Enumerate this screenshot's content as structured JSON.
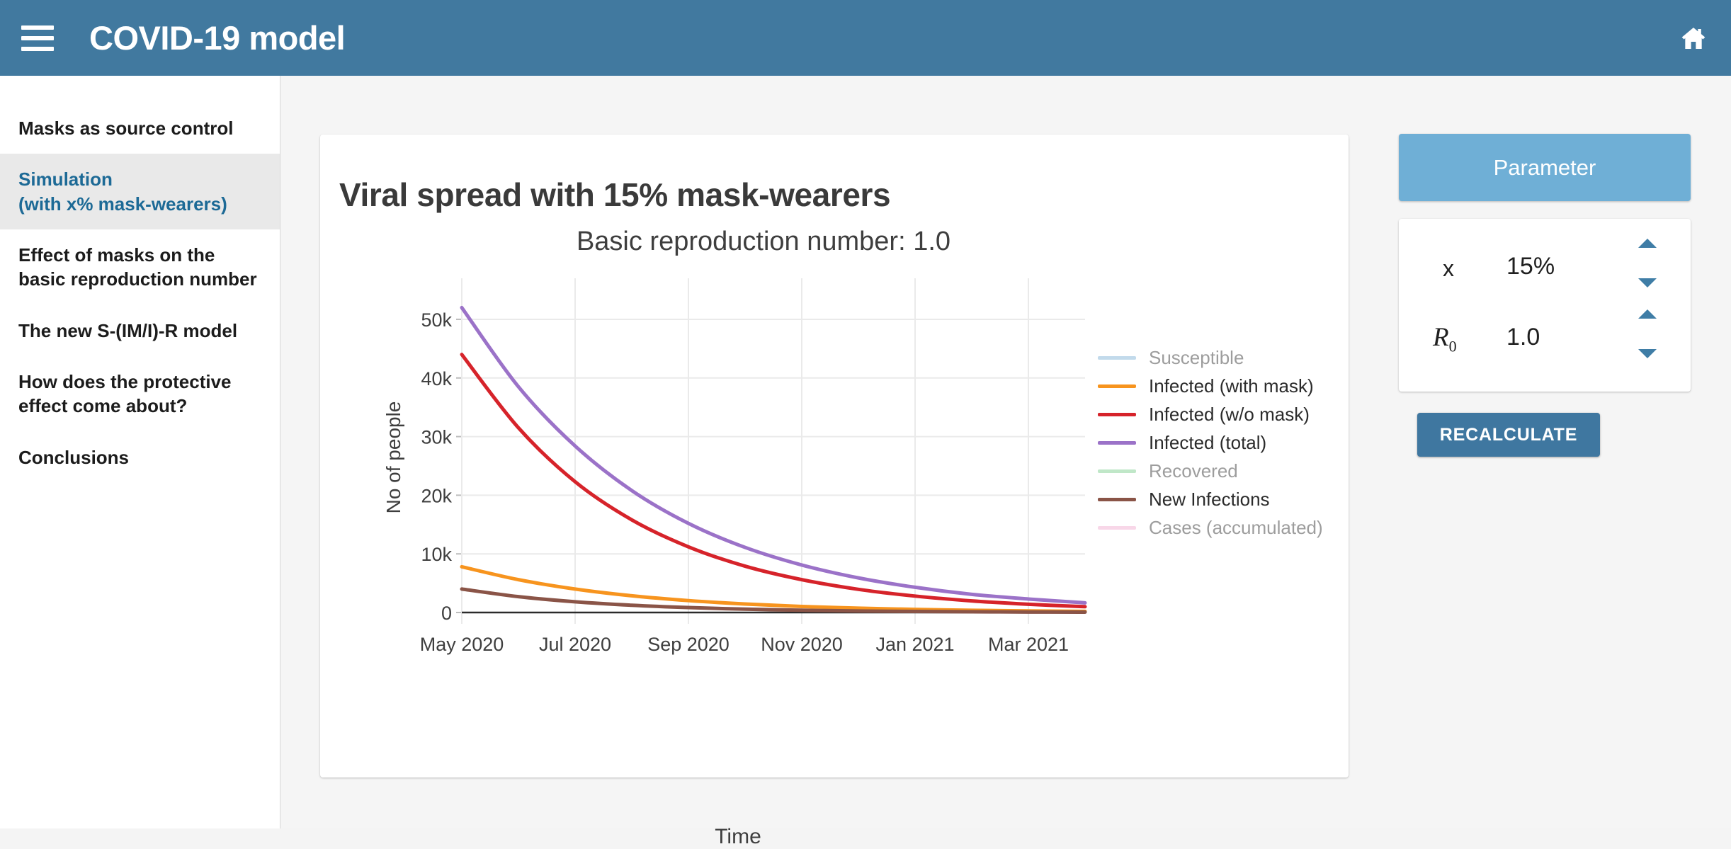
{
  "header": {
    "title": "COVID-19 model",
    "menu_icon": "hamburger-icon",
    "home_icon": "home-icon",
    "background_color": "#41799f"
  },
  "sidebar": {
    "items": [
      {
        "label": "Masks as source control",
        "active": false
      },
      {
        "label": "Simulation\n(with x% mask-wearers)",
        "active": true
      },
      {
        "label": "Effect of masks on the basic reproduction number",
        "active": false
      },
      {
        "label": "The new S-(IM/I)-R model",
        "active": false
      },
      {
        "label": "How does the protective effect come about?",
        "active": false
      },
      {
        "label": "Conclusions",
        "active": false
      }
    ],
    "active_color": "#1d6a96",
    "active_background": "#e9e9e9"
  },
  "parameters": {
    "header_label": "Parameter",
    "rows": [
      {
        "symbol": "x",
        "symbol_style": "plain",
        "value": "15%"
      },
      {
        "symbol": "R",
        "symbol_sub": "0",
        "symbol_style": "math",
        "value": "1.0"
      }
    ],
    "spinner_up_icon": "triangle-up-icon",
    "spinner_down_icon": "triangle-down-icon",
    "recalculate_label": "RECALCULATE",
    "accent_color": "#3f77a0",
    "header_color": "#6fafd6"
  },
  "chart_data": {
    "type": "line",
    "title": "Viral spread with 15% mask-wearers",
    "subtitle": "Basic reproduction number: 1.0",
    "xlabel": "Time",
    "ylabel": "No of people",
    "grid": true,
    "legend_position": "right",
    "xtick_labels": [
      "May 2020",
      "Jul 2020",
      "Sep 2020",
      "Nov 2020",
      "Jan 2021",
      "Mar 2021"
    ],
    "ytick_labels": [
      "0",
      "10k",
      "20k",
      "30k",
      "40k",
      "50k"
    ],
    "ytick_values": [
      0,
      10000,
      20000,
      30000,
      40000,
      50000
    ],
    "ylim": [
      0,
      57000
    ],
    "xlim": [
      "2020-04-15",
      "2021-04-15"
    ],
    "x": [
      "May 2020",
      "Jun 2020",
      "Jul 2020",
      "Aug 2020",
      "Sep 2020",
      "Oct 2020",
      "Nov 2020",
      "Dec 2020",
      "Jan 2021",
      "Feb 2021",
      "Mar 2021",
      "Apr 2021"
    ],
    "series": [
      {
        "name": "Susceptible",
        "color": "#8fbcdb",
        "visible": false,
        "values": [
          null,
          null,
          null,
          null,
          null,
          null,
          null,
          null,
          null,
          null,
          null,
          null
        ]
      },
      {
        "name": "Infected (with mask)",
        "color": "#f7941e",
        "visible": true,
        "values": [
          7800,
          5600,
          4000,
          2850,
          2030,
          1450,
          1030,
          740,
          530,
          380,
          270,
          190
        ]
      },
      {
        "name": "Infected (w/o mask)",
        "color": "#d6232a",
        "visible": true,
        "values": [
          44000,
          31500,
          22300,
          15800,
          11200,
          7900,
          5600,
          3950,
          2800,
          1980,
          1400,
          990
        ]
      },
      {
        "name": "Infected (total)",
        "color": "#9b72c8",
        "visible": true,
        "values": [
          52000,
          38500,
          28400,
          20800,
          15200,
          11100,
          8100,
          5900,
          4300,
          3100,
          2300,
          1650
        ]
      },
      {
        "name": "Recovered",
        "color": "#8cd39a",
        "visible": false,
        "values": [
          null,
          null,
          null,
          null,
          null,
          null,
          null,
          null,
          null,
          null,
          null,
          null
        ]
      },
      {
        "name": "New Infections",
        "color": "#8a5447",
        "visible": true,
        "values": [
          4000,
          2700,
          1830,
          1240,
          840,
          570,
          385,
          260,
          177,
          120,
          81,
          55
        ]
      },
      {
        "name": "Cases (accumulated)",
        "color": "#f3b6d6",
        "visible": false,
        "values": [
          null,
          null,
          null,
          null,
          null,
          null,
          null,
          null,
          null,
          null,
          null,
          null
        ]
      }
    ]
  }
}
